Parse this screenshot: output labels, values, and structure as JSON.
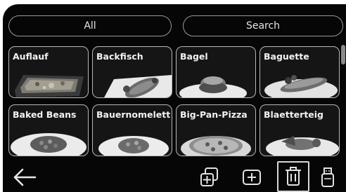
{
  "topbar": {
    "all_label": "All",
    "search_label": "Search"
  },
  "tiles": [
    {
      "label": "Auflauf"
    },
    {
      "label": "Backfisch"
    },
    {
      "label": "Bagel"
    },
    {
      "label": "Baguette"
    },
    {
      "label": "Baked Beans"
    },
    {
      "label": "Bauernomelett"
    },
    {
      "label": "Big-Pan-Pizza"
    },
    {
      "label": "Blaetterteig"
    }
  ],
  "icons": {
    "back": "arrow-left-icon",
    "copy": "copy-plus-icon",
    "add": "plus-box-icon",
    "delete": "trash-icon",
    "usb": "usb-stick-icon"
  }
}
